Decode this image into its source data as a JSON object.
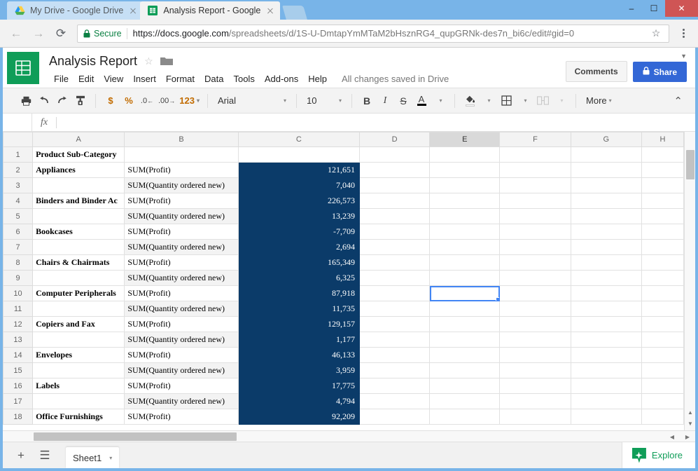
{
  "browser": {
    "tabs": [
      {
        "title": "My Drive - Google Drive",
        "favicon": "drive-icon",
        "active": false
      },
      {
        "title": "Analysis Report - Google",
        "favicon": "sheets-icon",
        "active": true
      }
    ],
    "window_controls": {
      "minimize": "–",
      "maximize": "☐",
      "close": "✕"
    },
    "nav": {
      "back": "←",
      "forward": "→",
      "reload": "⟳"
    },
    "omnibox": {
      "security_label": "Secure",
      "url_prefix": "https://docs.google.com",
      "url_path": "/spreadsheets/d/1S-U-DmtapYmMTaM2bHsznRG4_qupGRNk-des7n_bi6c/edit#gid=0",
      "full_url": "https://docs.google.com/spreadsheets/d/1S-U-DmtapYmMTaM2bHsznRG4_qupGRNk-des7n_bi6c/edit#gid=0",
      "bookmark_star": "☆"
    }
  },
  "doc": {
    "title": "Analysis Report",
    "star": "☆",
    "menus": [
      "File",
      "Edit",
      "View",
      "Insert",
      "Format",
      "Data",
      "Tools",
      "Add-ons",
      "Help"
    ],
    "save_status": "All changes saved in Drive",
    "comments_label": "Comments",
    "share_label": "Share",
    "collapse_caret": "▼"
  },
  "toolbar": {
    "print": "⎙",
    "undo": "↶",
    "redo": "↷",
    "paint_format": "paint-format",
    "currency": "$",
    "percent": "%",
    "decrease_decimal": ".0",
    "increase_decimal": ".00",
    "number_format": "123",
    "font_family": "Arial",
    "font_size": "10",
    "bold": "B",
    "italic": "I",
    "strikethrough": "S",
    "text_color": "A",
    "fill_color": "fill-color",
    "borders": "borders",
    "merge_cells": "merge-cells",
    "more_label": "More",
    "collapse": "⌃",
    "caret": "▾"
  },
  "formula_bar": {
    "fx_label": "fx",
    "value": "",
    "name_box": ""
  },
  "grid": {
    "columns": [
      "A",
      "B",
      "C",
      "D",
      "E",
      "F",
      "G",
      "H"
    ],
    "selected_column": "E",
    "selected_cell": "E10",
    "rows": [
      {
        "n": "1",
        "a": "Product Sub-Category",
        "b": "",
        "c": ""
      },
      {
        "n": "2",
        "a": "Appliances",
        "b": "SUM(Profit)",
        "c": "121,651"
      },
      {
        "n": "3",
        "a": "",
        "b": "SUM(Quantity ordered new)",
        "c": "7,040"
      },
      {
        "n": "4",
        "a": "Binders and Binder Ac",
        "b": "SUM(Profit)",
        "c": "226,573"
      },
      {
        "n": "5",
        "a": "",
        "b": "SUM(Quantity ordered new)",
        "c": "13,239"
      },
      {
        "n": "6",
        "a": "Bookcases",
        "b": "SUM(Profit)",
        "c": "-7,709"
      },
      {
        "n": "7",
        "a": "",
        "b": "SUM(Quantity ordered new)",
        "c": "2,694"
      },
      {
        "n": "8",
        "a": "Chairs & Chairmats",
        "b": "SUM(Profit)",
        "c": "165,349"
      },
      {
        "n": "9",
        "a": "",
        "b": "SUM(Quantity ordered new)",
        "c": "6,325"
      },
      {
        "n": "10",
        "a": "Computer Peripherals",
        "b": "SUM(Profit)",
        "c": "87,918"
      },
      {
        "n": "11",
        "a": "",
        "b": "SUM(Quantity ordered new)",
        "c": "11,735"
      },
      {
        "n": "12",
        "a": "Copiers and Fax",
        "b": "SUM(Profit)",
        "c": "129,157"
      },
      {
        "n": "13",
        "a": "",
        "b": "SUM(Quantity ordered new)",
        "c": "1,177"
      },
      {
        "n": "14",
        "a": "Envelopes",
        "b": "SUM(Profit)",
        "c": "46,133"
      },
      {
        "n": "15",
        "a": "",
        "b": "SUM(Quantity ordered new)",
        "c": "3,959"
      },
      {
        "n": "16",
        "a": "Labels",
        "b": "SUM(Profit)",
        "c": "17,775"
      },
      {
        "n": "17",
        "a": "",
        "b": "SUM(Quantity ordered new)",
        "c": "4,794"
      },
      {
        "n": "18",
        "a": "Office Furnishings",
        "b": "SUM(Profit)",
        "c": "92,209"
      }
    ]
  },
  "bottom": {
    "add_sheet": "+",
    "all_sheets": "☰",
    "sheet_tab": "Sheet1",
    "sheet_caret": "▾",
    "explore_label": "Explore"
  },
  "colors": {
    "navy_cell": "#0b3b69",
    "brand_green": "#0f9d58",
    "share_blue": "#3367d6",
    "selection_blue": "#4285f4",
    "secure_green": "#0b8043",
    "window_blue": "#78b4e8"
  }
}
